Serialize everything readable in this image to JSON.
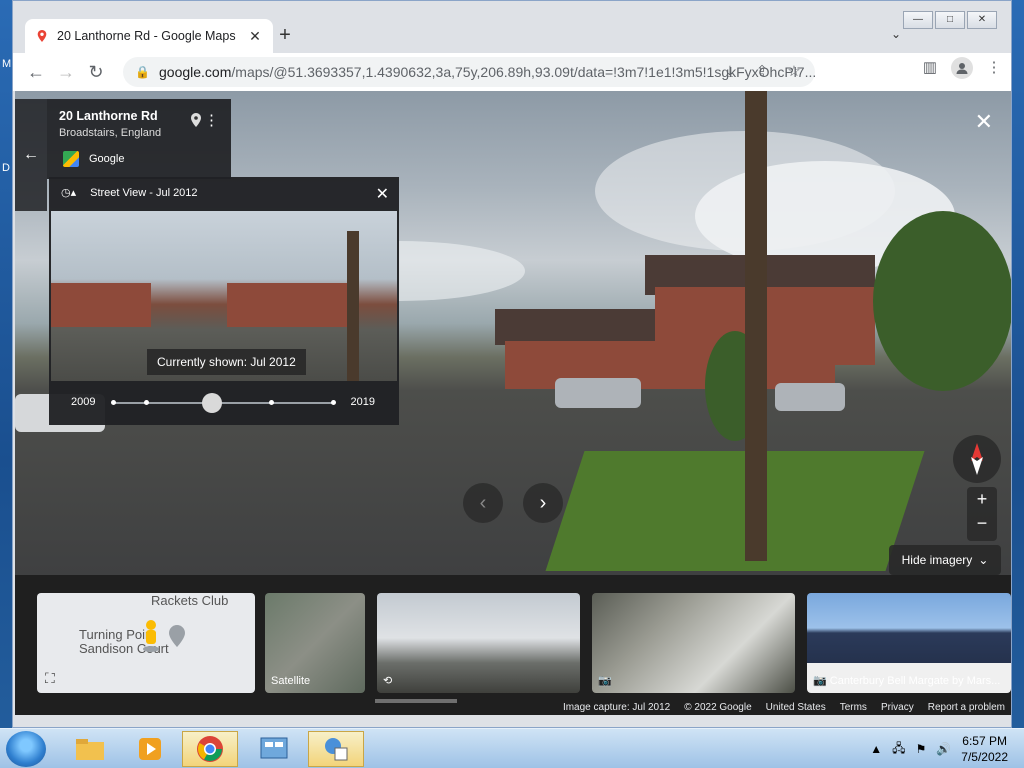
{
  "desktop": {
    "frag1": "M",
    "frag2": "D"
  },
  "browser": {
    "tab_title": "20 Lanthorne Rd - Google Maps",
    "url_host": "google.com",
    "url_path": "/maps/@51.3693357,1.4390632,3a,75y,206.89h,93.09t/data=!3m7!1e1!3m5!1sgkFyxOhcPl7...",
    "win_controls": [
      "—",
      "□",
      "✕"
    ]
  },
  "maps": {
    "address_title": "20 Lanthorne Rd",
    "address_sub": "Broadstairs, England",
    "provider": "Google",
    "time_machine": {
      "header": "Street View - Jul 2012",
      "tooltip": "Currently shown: Jul 2012",
      "start_year": "2009",
      "end_year": "2019",
      "tick_fractions": [
        0,
        0.15,
        0.45,
        0.72,
        1.0
      ],
      "thumb_fraction": 0.45
    },
    "hide_imagery": "Hide imagery",
    "strip": {
      "map_labels": [
        "Rackets Club",
        "Turning Point",
        "Sandison Court"
      ],
      "satellite_label": "Satellite",
      "photo_label": "Canterbury Bell Margate by Mars..."
    },
    "footer": [
      "Image capture: Jul 2012",
      "© 2022 Google",
      "United States",
      "Terms",
      "Privacy",
      "Report a problem"
    ]
  },
  "taskbar": {
    "time": "6:57 PM",
    "date": "7/5/2022"
  },
  "colors": {
    "accent": "#1a73e8",
    "window_bg": "#dee1e6",
    "dark_panel": "#202124"
  }
}
